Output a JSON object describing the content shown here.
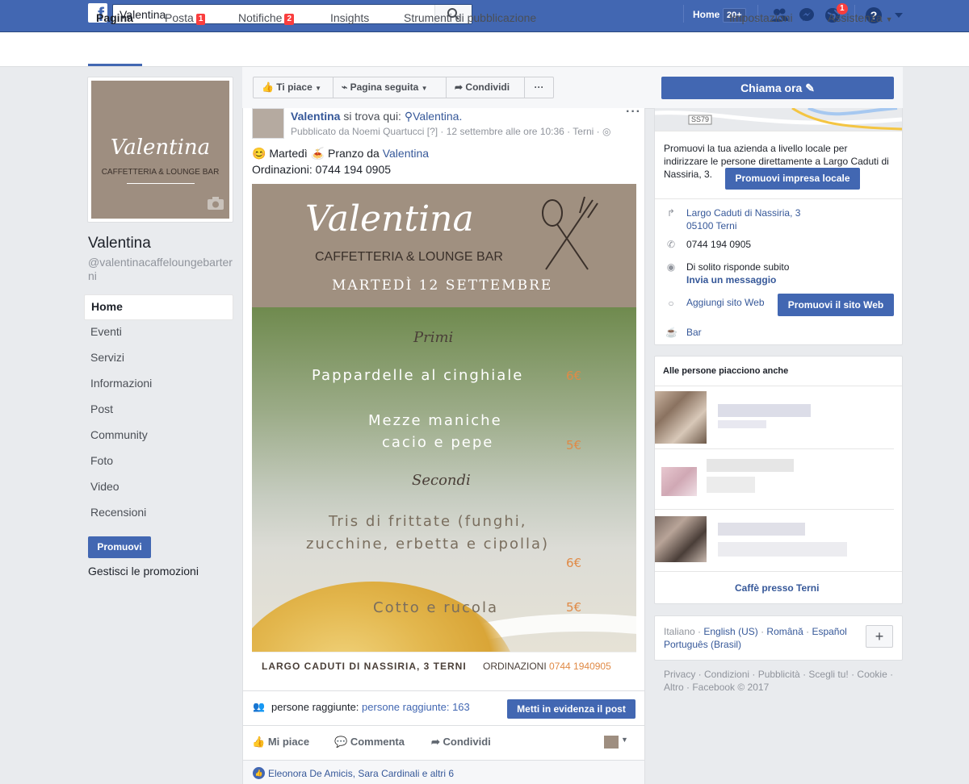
{
  "topbar": {
    "search_value": "Valentina",
    "home_label": "Home",
    "home_badge": "20+",
    "notif_badge": "1"
  },
  "pagenav": {
    "items": [
      {
        "label": "Pagina",
        "badge": ""
      },
      {
        "label": "Posta",
        "badge": "1"
      },
      {
        "label": "Notifiche",
        "badge": "2"
      },
      {
        "label": "Insights",
        "badge": ""
      },
      {
        "label": "Strumenti di pubblicazione",
        "badge": ""
      }
    ],
    "settings": "Impostazioni",
    "help": "Assistenza"
  },
  "profile": {
    "pic_name": "Valentina",
    "pic_subtitle": "CAFFETTERIA & LOUNGE BAR",
    "name": "Valentina",
    "handle": "@valentinacaffeloungebarterni"
  },
  "side_nav": [
    "Home",
    "Eventi",
    "Servizi",
    "Informazioni",
    "Post",
    "Community",
    "Foto",
    "Video",
    "Recensioni"
  ],
  "promote_label": "Promuovi",
  "manage_promos": "Gestisci le promozioni",
  "actionbar": {
    "like": "Ti piace",
    "follow": "Pagina seguita",
    "share": "Condividi",
    "call": "Chiama ora"
  },
  "post": {
    "author": "Valentina",
    "located_text": "si trova qui:",
    "location": "Valentina.",
    "meta": "Pubblicato da Noemi Quartucci [?] · 12 settembre alle ore 10:36 · Terni · ",
    "line1_prefix": "😊 Martedì 🍝 Pranzo da ",
    "line1_link": "Valentina",
    "line2": "Ordinazioni: 0744 194 0905",
    "image": {
      "brand": "Valentina",
      "subtitle": "CAFFETTERIA & LOUNGE BAR",
      "date": "MARTEDÌ 12 SETTEMBRE",
      "section1": "Primi",
      "dish1": "Pappardelle al cinghiale",
      "price1": "6€",
      "dish2a": "Mezze maniche",
      "dish2b": "cacio e pepe",
      "price2": "5€",
      "section2": "Secondi",
      "dish3a": "Tris di frittate (funghi,",
      "dish3b": "zucchine, erbetta e cipolla)",
      "price3": "6€",
      "dish4": "Cotto e rucola",
      "price4": "5€",
      "address": "LARGO CADUTI DI NASSIRIA, 3 TERNI",
      "orders_label": "ORDINAZIONI",
      "orders_phone": "0744 1940905"
    },
    "reach_label": "persone raggiunte:",
    "reach_value": "persone raggiunte: 163",
    "boost": "Metti in evidenza il post",
    "react_like": "Mi piace",
    "react_comment": "Commenta",
    "react_share": "Condividi",
    "likers": "Eleonora De Amicis, Sara Cardinali e altri 6"
  },
  "right": {
    "map_label": "SS79",
    "promo_text": "Promuovi la tua azienda a livello locale per indirizzare le persone direttamente a Largo Caduti di Nassiria, 3.",
    "promo_btn": "Promuovi impresa locale",
    "address1": "Largo Caduti di Nassiria, 3",
    "address2": "05100 Terni",
    "phone": "0744 194 0905",
    "responds": "Di solito risponde subito",
    "send_msg": "Invia un messaggio",
    "add_site": "Aggiungi sito Web",
    "promo_web": "Promuovi il sito Web",
    "category": "Bar",
    "alike_title": "Alle persone piacciono anche",
    "alike_footer": "Caffè presso Terni",
    "langs": [
      {
        "label": "Italiano",
        "link": false
      },
      {
        "label": "English (US)",
        "link": true
      },
      {
        "label": "Română",
        "link": true
      },
      {
        "label": "Español",
        "link": true
      },
      {
        "label": "Português (Brasil)",
        "link": true
      }
    ],
    "footer": "Privacy · Condizioni · Pubblicità · Scegli tu! · Cookie · Altro · Facebook © 2017"
  }
}
